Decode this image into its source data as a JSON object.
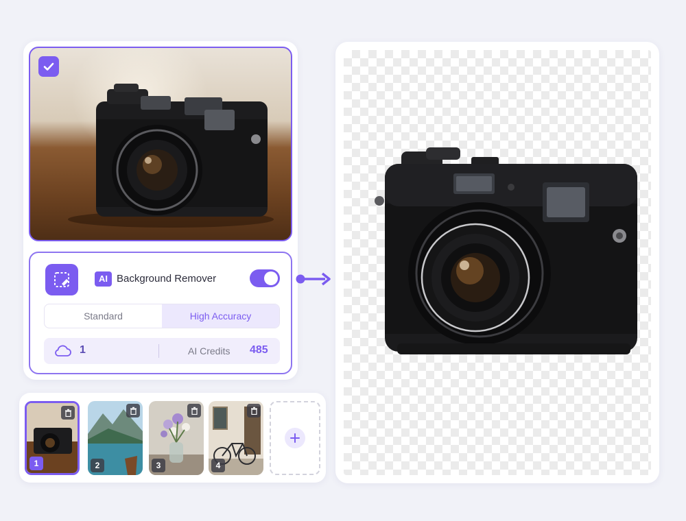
{
  "tool": {
    "ai_badge": "AI",
    "title": "Background Remover",
    "enabled": true,
    "modes": [
      "Standard",
      "High Accuracy"
    ],
    "selected_mode": "High Accuracy"
  },
  "credits": {
    "count": "1",
    "label": "AI Credits",
    "value": "485"
  },
  "thumbnails": [
    {
      "number": "1",
      "subject": "camera",
      "selected": true
    },
    {
      "number": "2",
      "subject": "mountain lake",
      "selected": false
    },
    {
      "number": "3",
      "subject": "flowers in vase",
      "selected": false
    },
    {
      "number": "4",
      "subject": "bicycle",
      "selected": false
    }
  ],
  "colors": {
    "accent": "#7b5cf0",
    "accent_light": "#ece8fd",
    "background": "#f1f2f8"
  },
  "icons": [
    "check-icon",
    "background-remove-icon",
    "cloud-icon",
    "arrow-right-icon",
    "trash-icon",
    "plus-icon"
  ]
}
